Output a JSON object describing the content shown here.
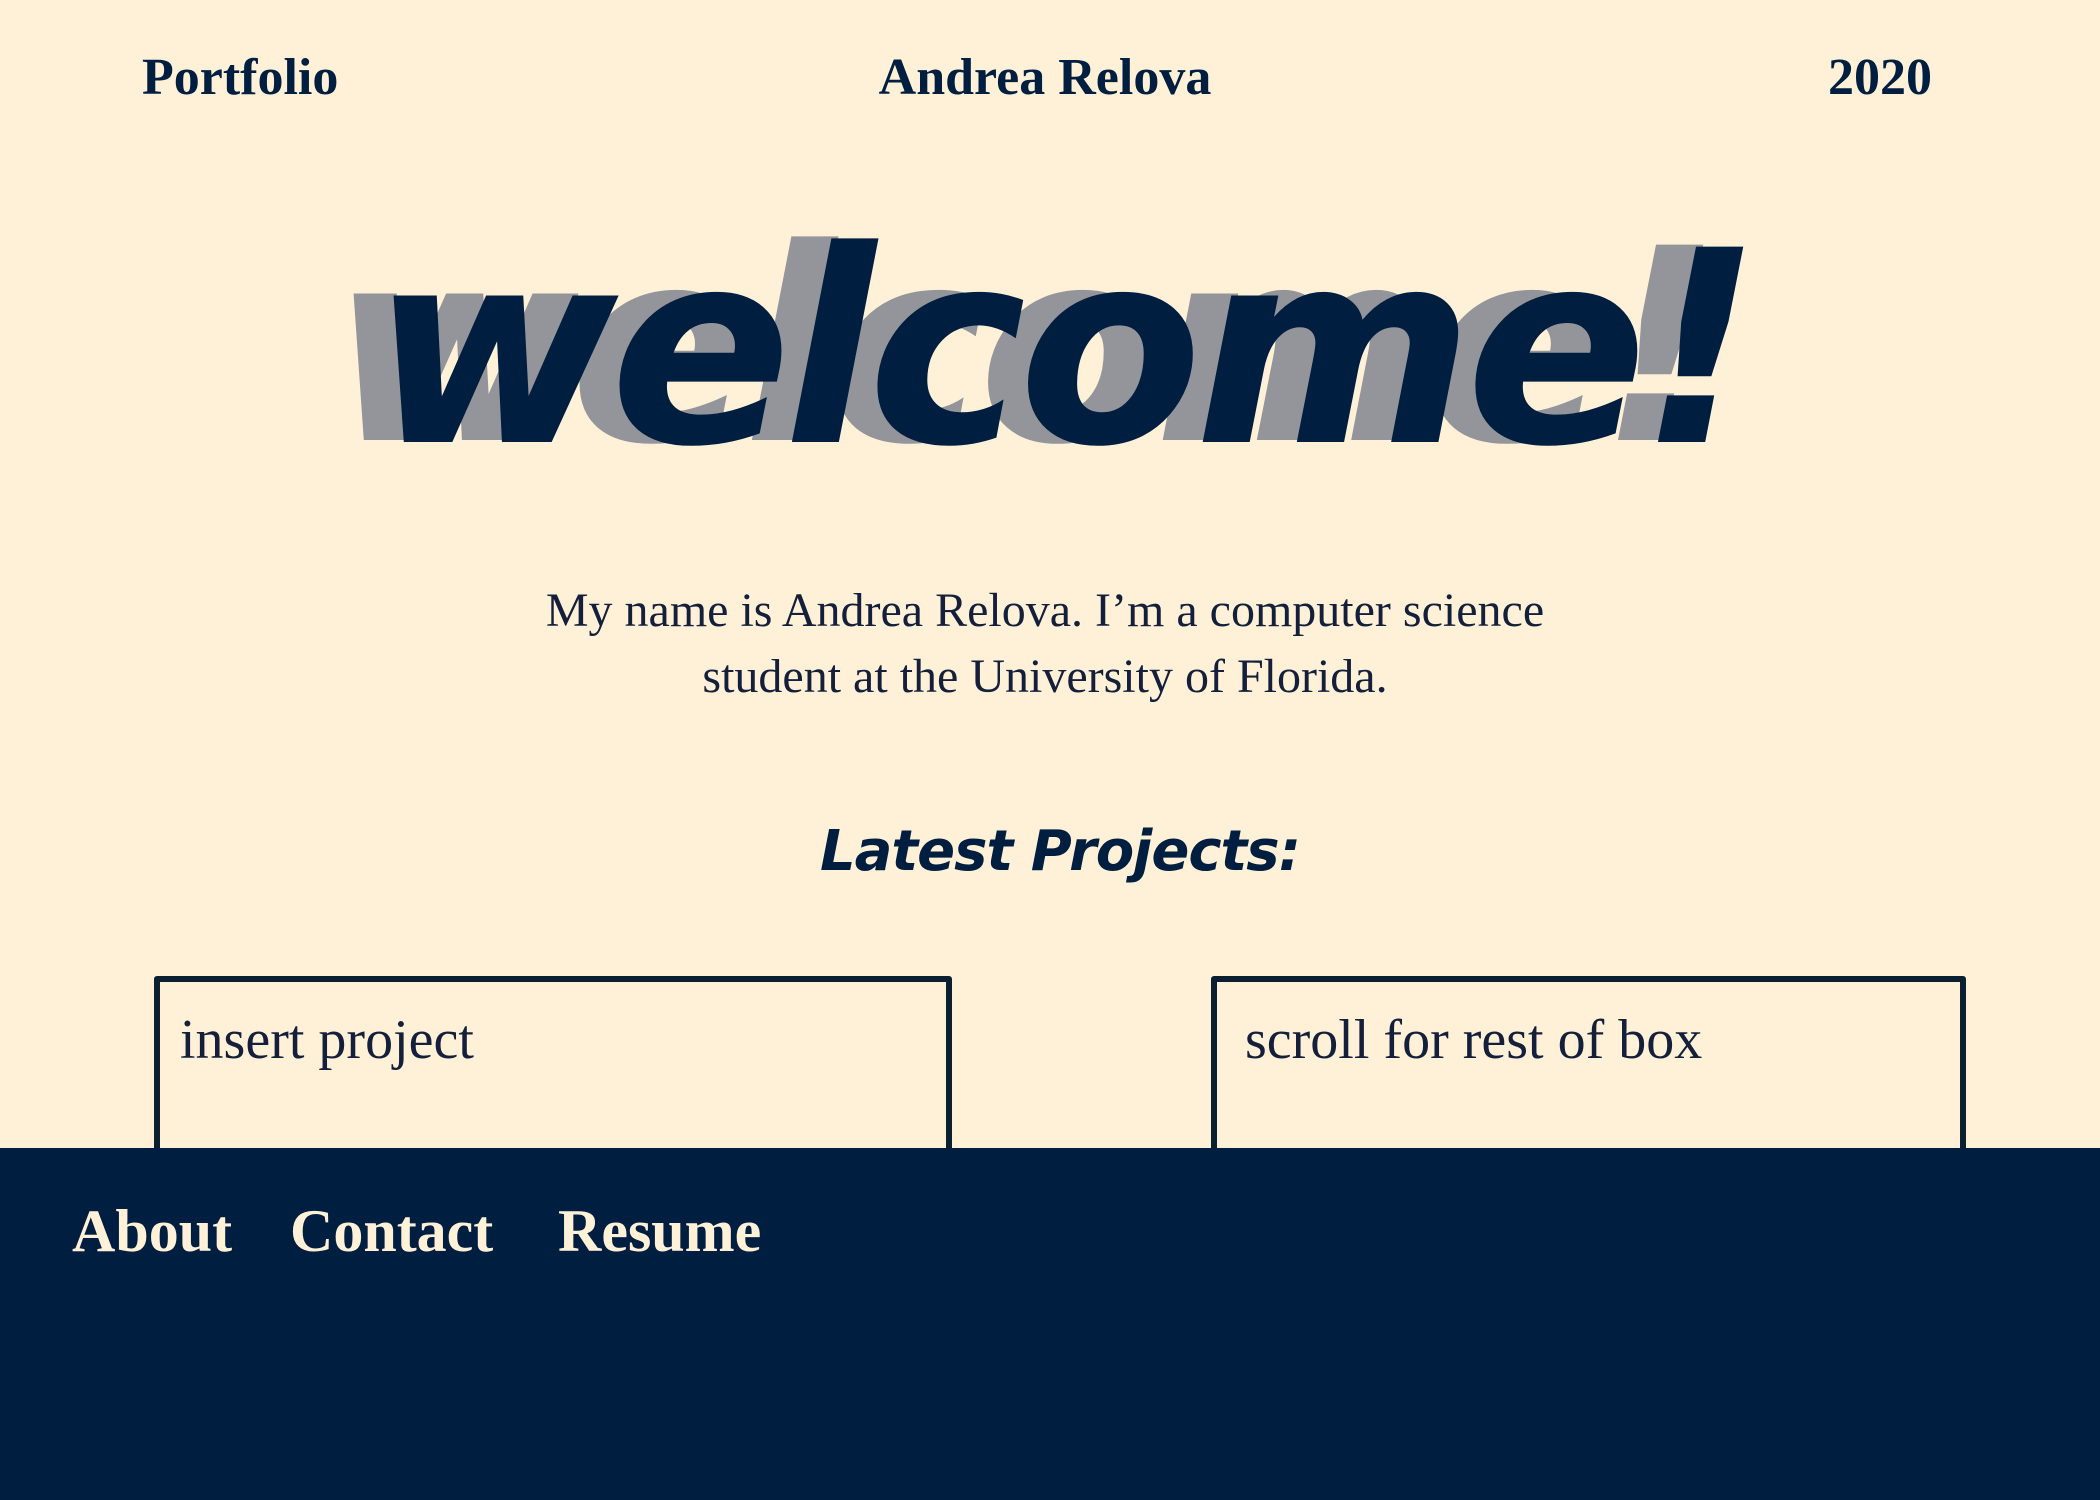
{
  "header": {
    "left_label": "Portfolio",
    "center_label": "Andrea Relova",
    "right_label": "2020"
  },
  "hero": {
    "headline": "welcome!",
    "intro_line_1": "My name is Andrea Relova. I’m a computer science",
    "intro_line_2": "student at the University of Florida."
  },
  "projects": {
    "heading": "Latest Projects:",
    "boxes": [
      {
        "text": "insert project"
      },
      {
        "text": "scroll for rest of box"
      }
    ]
  },
  "footer": {
    "nav": [
      {
        "label": "About"
      },
      {
        "label": "Contact"
      },
      {
        "label": "Resume"
      }
    ]
  },
  "colors": {
    "background": "#FFF1D7",
    "navy": "#001E3F",
    "shadow_gray": "#94959A"
  }
}
